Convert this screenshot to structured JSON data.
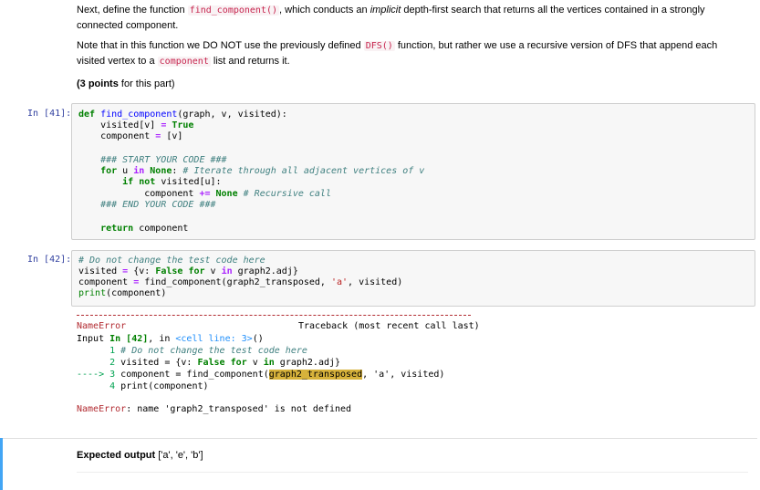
{
  "md1": {
    "text1": "Next, define the function ",
    "code1": "find_component()",
    "text2": ", which conducts an ",
    "em1": "implicit",
    "text3": " depth-first search that returns all the vertices contained in a strongly connected component."
  },
  "md2": {
    "text1": "Note that in this function we DO NOT use the previously defined ",
    "code1": "DFS()",
    "text2": " function, but rather we use a recursive version of DFS that append each visited vertex to a ",
    "code2": "component",
    "text3": " list and returns it."
  },
  "md3": {
    "bold": "(3 points",
    "rest": " for this part)"
  },
  "cell41": {
    "prompt": "In [41]:",
    "l1_kw": "def",
    "l1_fn": "find_component",
    "l1_rest": "(graph, v, visited):",
    "l2_a": "    visited[v] ",
    "l2_op": "=",
    "l2_kw": " True",
    "l3_a": "    component ",
    "l3_op": "=",
    "l3_b": " [v]",
    "l5_cm": "    ### START YOUR CODE ###",
    "l6_kw": "    for",
    "l6_a": " u ",
    "l6_in": "in",
    "l6_none": " None",
    "l6_b": ": ",
    "l6_cm": "# Iterate through all adjacent vertices of v",
    "l7_kw": "        if not",
    "l7_a": " visited[u]:",
    "l8_a": "            component ",
    "l8_op": "+=",
    "l8_none": " None",
    "l8_cm": " # Recursive call",
    "l9_cm": "    ### END YOUR CODE ###",
    "l11_kw": "    return",
    "l11_a": " component"
  },
  "cell42": {
    "prompt": "In [42]:",
    "l1_cm": "# Do not change the test code here",
    "l2_a": "visited ",
    "l2_op": "=",
    "l2_b": " {v: ",
    "l2_false": "False",
    "l2_for": " for",
    "l2_c": " v ",
    "l2_in": "in",
    "l2_d": " graph2.adj}",
    "l3_a": "component ",
    "l3_op": "=",
    "l3_b": " find_component(graph2_transposed, ",
    "l3_str": "'a'",
    "l3_c": ", visited)",
    "l4_print": "print",
    "l4_a": "(component)"
  },
  "output": {
    "err_name": "NameError",
    "traceback": "Traceback (most recent call last)",
    "input_label": "Input ",
    "input_in": "In [42]",
    "input_mid": ", in ",
    "cell_line": "<cell line: 3>",
    "input_end": "()",
    "t1_num": "      1",
    "t1_text": " # Do not change the test code here",
    "t2_num": "      2",
    "t2_a": " visited = {v: ",
    "t2_false": "False",
    "t2_for": " for",
    "t2_b": " v ",
    "t2_in": "in",
    "t2_c": " graph2.adj}",
    "t3_arrow": "----> 3",
    "t3_a": " component = find_component(",
    "t3_hl": "graph2_transposed",
    "t3_b": ", 'a', visited)",
    "t4_num": "      4",
    "t4_a": " print(component)",
    "final_name": "NameError",
    "final_msg": ": name 'graph2_transposed' is not defined"
  },
  "expected": {
    "bold": "Expected output",
    "value": " ['a', 'e', 'b']"
  }
}
